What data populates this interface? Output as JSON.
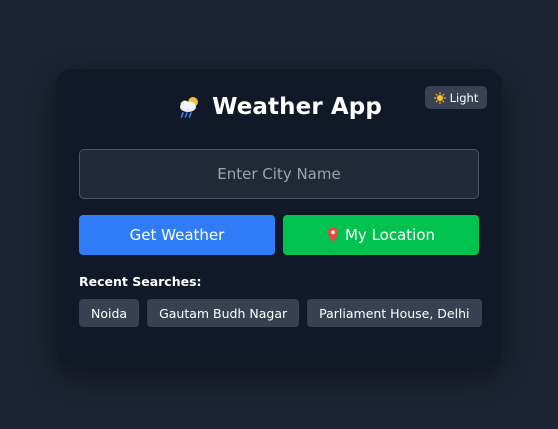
{
  "header": {
    "title": "Weather App",
    "title_icon": "cloud-rain-sun-icon"
  },
  "theme_toggle": {
    "label": "Light",
    "icon": "sun-icon"
  },
  "search": {
    "placeholder": "Enter City Name",
    "value": ""
  },
  "buttons": {
    "get_weather": "Get Weather",
    "my_location": "My Location",
    "location_icon": "pin-icon"
  },
  "recent": {
    "label": "Recent Searches:",
    "items": [
      "Noida",
      "Gautam Budh Nagar",
      "Parliament House, Delhi"
    ]
  },
  "colors": {
    "page_bg": "#1c2333",
    "card_bg": "#111827",
    "primary": "#2f7cf6",
    "success": "#00c24e",
    "chip_bg": "#374151"
  }
}
